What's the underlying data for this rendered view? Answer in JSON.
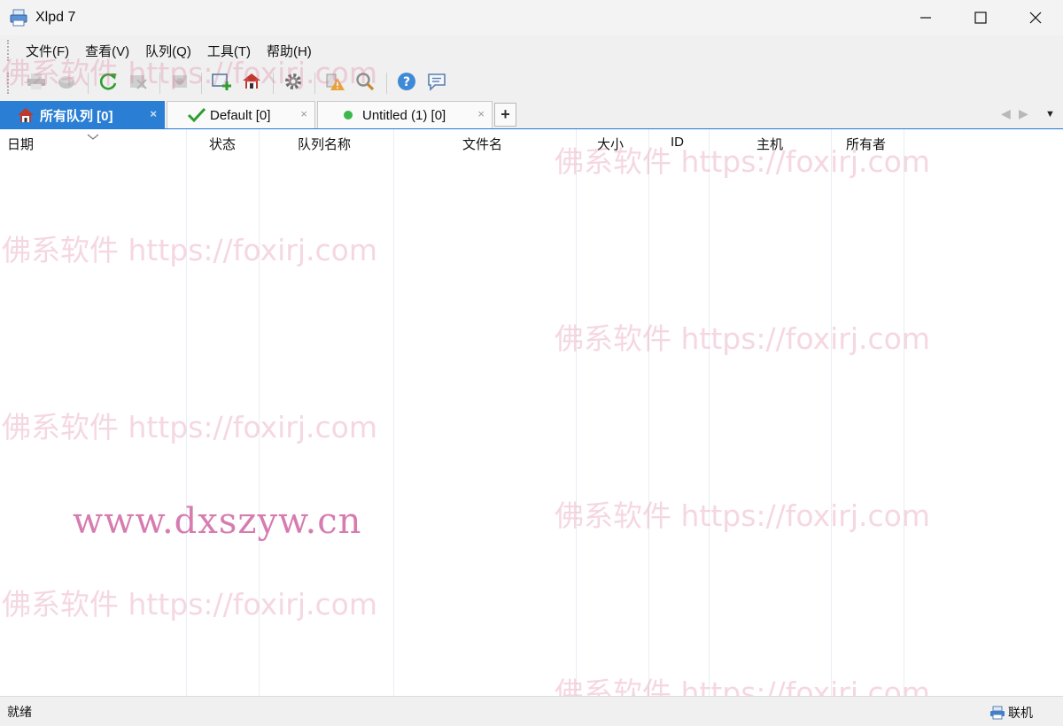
{
  "window": {
    "title": "Xlpd 7"
  },
  "menu": {
    "items": [
      "文件(F)",
      "查看(V)",
      "队列(Q)",
      "工具(T)",
      "帮助(H)"
    ]
  },
  "toolbar": {
    "buttons": [
      "printer-icon",
      "disk-icon",
      "refresh-icon",
      "delete-icon",
      "properties-icon",
      "add-queue-icon",
      "home-icon",
      "settings-icon",
      "warning-icon",
      "search-icon",
      "help-icon",
      "chat-icon"
    ]
  },
  "tabs": {
    "items": [
      {
        "label": "所有队列 [0]",
        "icon": "home-icon"
      },
      {
        "label": "Default [0]",
        "icon": "check-icon"
      },
      {
        "label": "Untitled (1) [0]",
        "icon": "green-dot-icon"
      }
    ],
    "add_label": "+",
    "close_glyph": "×"
  },
  "columns": [
    "日期",
    "状态",
    "队列名称",
    "文件名",
    "大小",
    "ID",
    "主机",
    "所有者"
  ],
  "statusbar": {
    "text": "就绪",
    "connection": "联机"
  },
  "watermarks": {
    "foxirj": "佛系软件 https://foxirj.com",
    "dxszyw": "www.dxszyw.cn"
  },
  "colors": {
    "accent": "#2a7fd4",
    "check": "#2e9e2e",
    "dot": "#3cb84a",
    "home_roof": "#c0392b"
  }
}
